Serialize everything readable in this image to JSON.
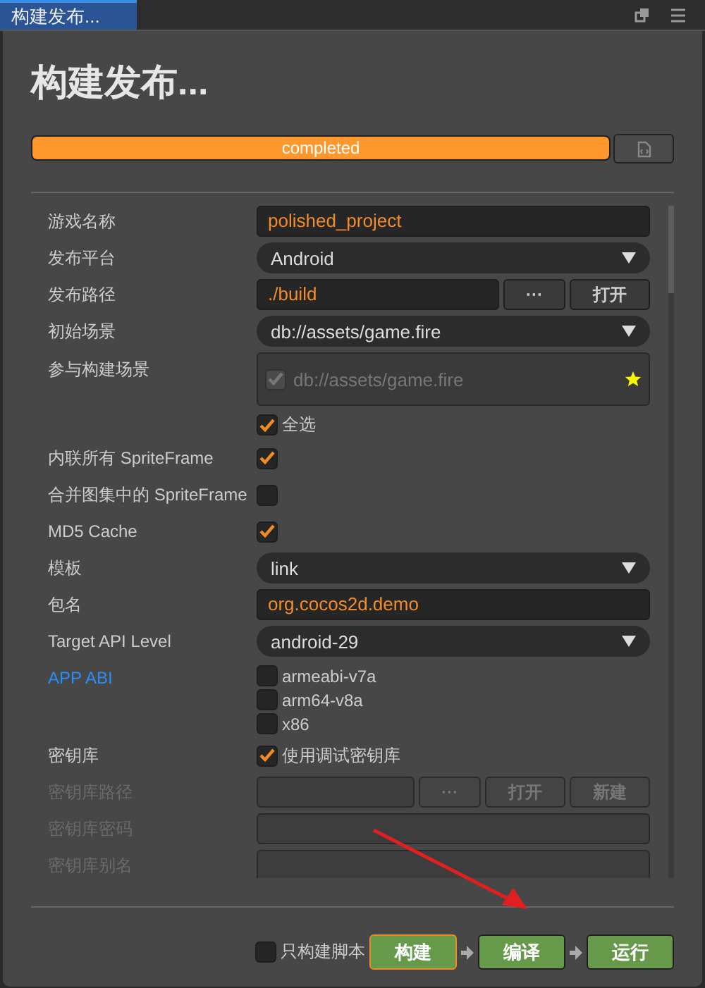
{
  "tab": {
    "title": "构建发布..."
  },
  "header": {
    "title": "构建发布..."
  },
  "progress": {
    "label": "completed",
    "level": 1
  },
  "rows": [
    {
      "kind": "input",
      "label": "游戏名称",
      "value": "polished_project",
      "disabled": false,
      "link": false
    },
    {
      "kind": "select",
      "label": "发布平台",
      "value": "Android",
      "disabled": false,
      "link": false
    },
    {
      "kind": "path",
      "label": "发布路径",
      "value": "./build",
      "buttons": [
        "···",
        "打开"
      ],
      "disabled": false,
      "link": false
    },
    {
      "kind": "select",
      "label": "初始场景",
      "value": "db://assets/game.fire",
      "disabled": false,
      "link": false
    },
    {
      "kind": "scenes",
      "label": "参与构建场景",
      "scenes": [
        {
          "name": "db://assets/game.fire",
          "checked": true
        }
      ],
      "select_all": {
        "label": "全选",
        "checked": true
      },
      "disabled": false,
      "link": false
    },
    {
      "kind": "checkbox",
      "label": "内联所有 SpriteFrame",
      "checked": true,
      "disabled": false,
      "link": false
    },
    {
      "kind": "checkbox",
      "label": "合并图集中的 SpriteFrame",
      "checked": false,
      "disabled": false,
      "link": false
    },
    {
      "kind": "checkbox",
      "label": "MD5 Cache",
      "checked": true,
      "disabled": false,
      "link": false
    },
    {
      "kind": "select",
      "label": "模板",
      "value": "link",
      "disabled": false,
      "link": false
    },
    {
      "kind": "input",
      "label": "包名",
      "value": "org.cocos2d.demo",
      "disabled": false,
      "link": false
    },
    {
      "kind": "select",
      "label": "Target API Level",
      "value": "android-29",
      "disabled": false,
      "link": false
    },
    {
      "kind": "options",
      "label": "APP ABI",
      "options": [
        {
          "label": "armeabi-v7a",
          "checked": false
        },
        {
          "label": "arm64-v8a",
          "checked": false
        },
        {
          "label": "x86",
          "checked": false
        }
      ],
      "disabled": false,
      "link": true
    },
    {
      "kind": "checkbox",
      "label": "密钥库",
      "checked": true,
      "text": "使用调试密钥库",
      "disabled": false,
      "link": false
    },
    {
      "kind": "path",
      "label": "密钥库路径",
      "buttons": [
        "···",
        "打开",
        "新建"
      ],
      "disabled": true,
      "link": false
    },
    {
      "kind": "input",
      "label": "密钥库密码",
      "disabled": true,
      "link": false
    },
    {
      "kind": "input",
      "label": "密钥库别名",
      "disabled": true,
      "link": false
    }
  ],
  "footer": {
    "script_only": {
      "label": "只构建脚本",
      "checked": false
    },
    "buttons": [
      {
        "label": "构建",
        "focused": true
      },
      {
        "label": "编译",
        "focused": false
      },
      {
        "label": "运行",
        "focused": false
      }
    ]
  }
}
